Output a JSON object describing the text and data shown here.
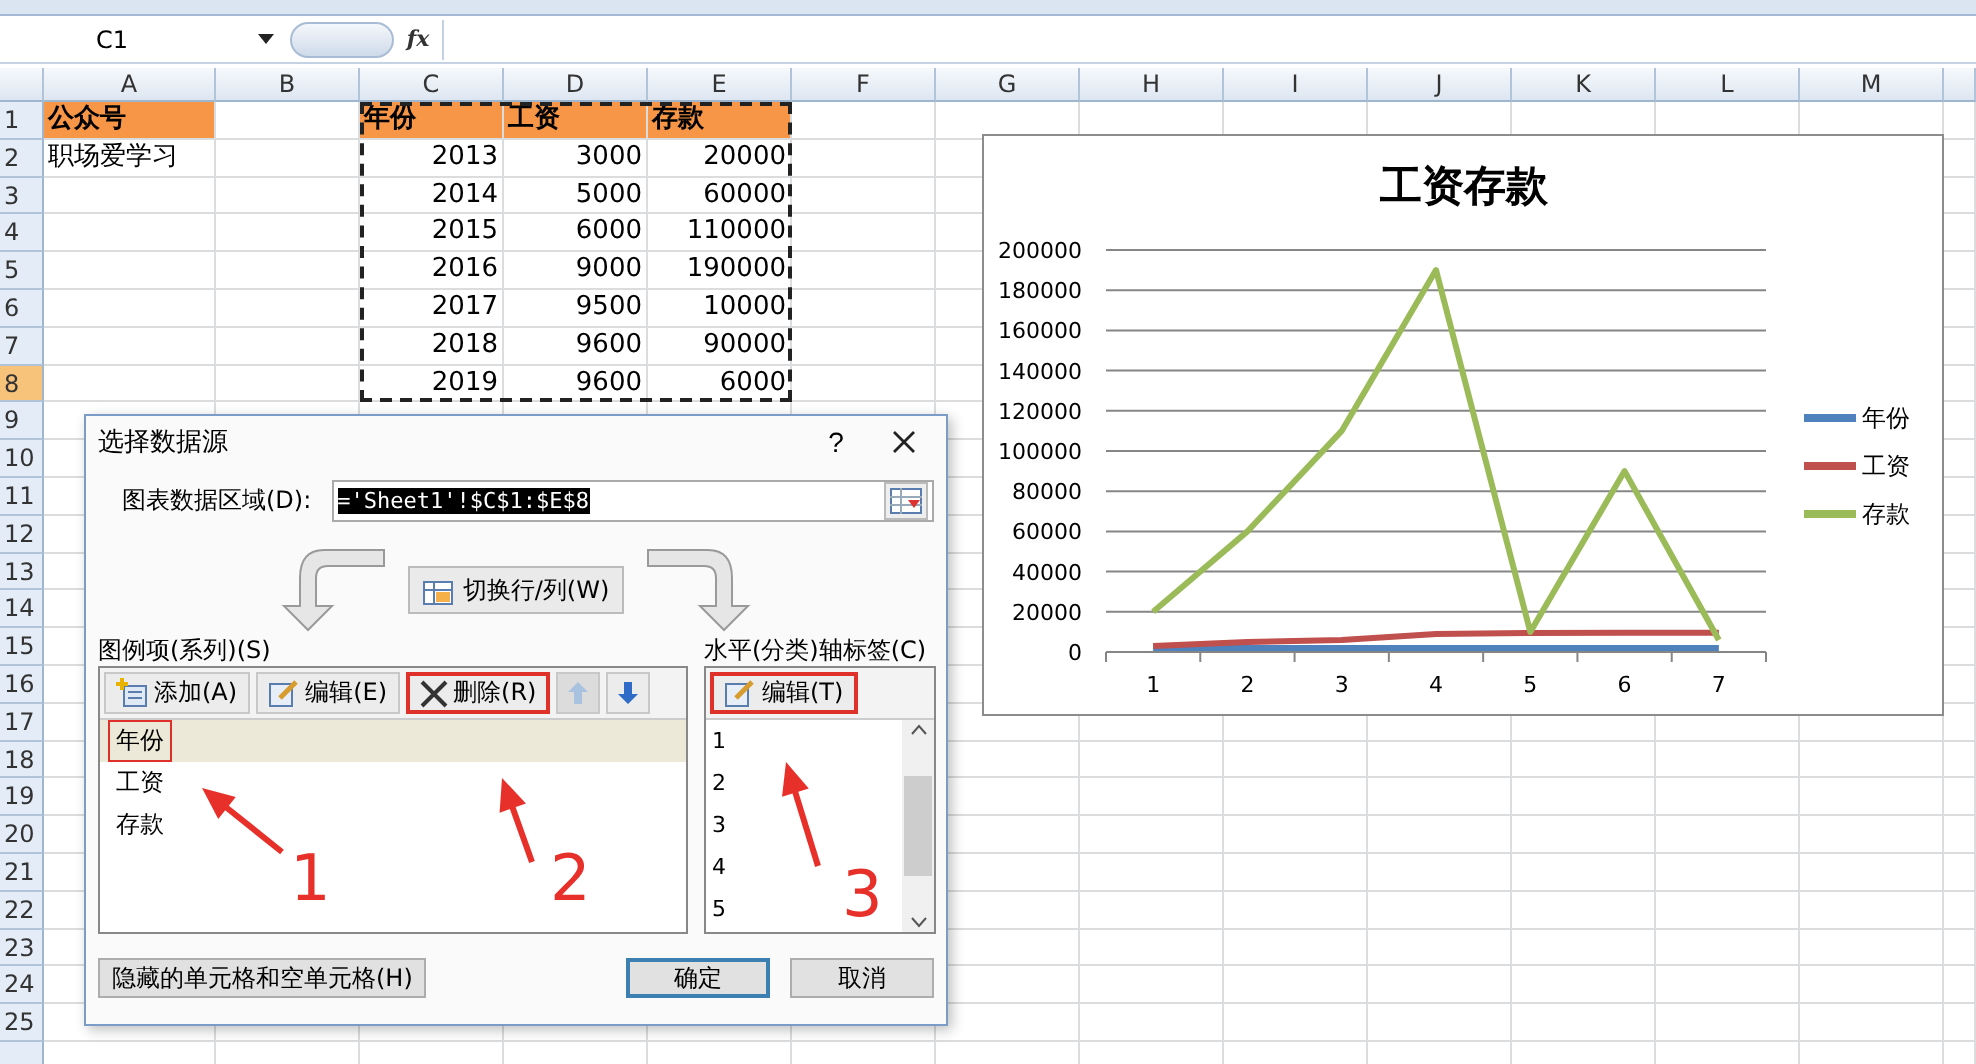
{
  "name_box": {
    "value": "C1"
  },
  "formula_bar": {
    "fx_label": "fx"
  },
  "columns": [
    "A",
    "B",
    "C",
    "D",
    "E",
    "F",
    "G",
    "H",
    "I",
    "J",
    "K",
    "L",
    "M"
  ],
  "rows": [
    {
      "header": "1",
      "selected": false,
      "cells": [
        {
          "kind": "header",
          "text": "公众号"
        },
        {
          "kind": "empty"
        },
        {
          "kind": "header",
          "text": "年份"
        },
        {
          "kind": "header",
          "text": "工资"
        },
        {
          "kind": "header",
          "text": "存款"
        }
      ]
    },
    {
      "header": "2",
      "selected": false,
      "cells": [
        {
          "kind": "text",
          "text": "职场爱学习"
        },
        {
          "kind": "empty"
        },
        {
          "kind": "number",
          "text": "2013"
        },
        {
          "kind": "number",
          "text": "3000"
        },
        {
          "kind": "number",
          "text": "20000"
        }
      ]
    },
    {
      "header": "3",
      "selected": false,
      "cells": [
        {
          "kind": "empty"
        },
        {
          "kind": "empty"
        },
        {
          "kind": "number",
          "text": "2014"
        },
        {
          "kind": "number",
          "text": "5000"
        },
        {
          "kind": "number",
          "text": "60000"
        }
      ]
    },
    {
      "header": "4",
      "selected": false,
      "cells": [
        {
          "kind": "empty"
        },
        {
          "kind": "empty"
        },
        {
          "kind": "number",
          "text": "2015"
        },
        {
          "kind": "number",
          "text": "6000"
        },
        {
          "kind": "number",
          "text": "110000"
        }
      ]
    },
    {
      "header": "5",
      "selected": false,
      "cells": [
        {
          "kind": "empty"
        },
        {
          "kind": "empty"
        },
        {
          "kind": "number",
          "text": "2016"
        },
        {
          "kind": "number",
          "text": "9000"
        },
        {
          "kind": "number",
          "text": "190000"
        }
      ]
    },
    {
      "header": "6",
      "selected": false,
      "cells": [
        {
          "kind": "empty"
        },
        {
          "kind": "empty"
        },
        {
          "kind": "number",
          "text": "2017"
        },
        {
          "kind": "number",
          "text": "9500"
        },
        {
          "kind": "number",
          "text": "10000"
        }
      ]
    },
    {
      "header": "7",
      "selected": false,
      "cells": [
        {
          "kind": "empty"
        },
        {
          "kind": "empty"
        },
        {
          "kind": "number",
          "text": "2018"
        },
        {
          "kind": "number",
          "text": "9600"
        },
        {
          "kind": "number",
          "text": "90000"
        }
      ]
    },
    {
      "header": "8",
      "selected": true,
      "cells": [
        {
          "kind": "empty"
        },
        {
          "kind": "empty"
        },
        {
          "kind": "number",
          "text": "2019"
        },
        {
          "kind": "number",
          "text": "9600"
        },
        {
          "kind": "number",
          "text": "6000"
        }
      ]
    },
    {
      "header": "9",
      "selected": false
    },
    {
      "header": "10",
      "selected": false
    },
    {
      "header": "11",
      "selected": false
    },
    {
      "header": "12",
      "selected": false
    },
    {
      "header": "13",
      "selected": false
    },
    {
      "header": "14",
      "selected": false
    },
    {
      "header": "15",
      "selected": false
    },
    {
      "header": "16",
      "selected": false
    },
    {
      "header": "17",
      "selected": false
    },
    {
      "header": "18",
      "selected": false
    },
    {
      "header": "19",
      "selected": false
    },
    {
      "header": "20",
      "selected": false
    },
    {
      "header": "21",
      "selected": false
    },
    {
      "header": "22",
      "selected": false
    },
    {
      "header": "23",
      "selected": false
    },
    {
      "header": "24",
      "selected": false
    },
    {
      "header": "25",
      "selected": false
    }
  ],
  "chart": {
    "chart_data": {
      "type": "line",
      "title": "工资存款",
      "grid": true,
      "legend": true,
      "categories": [
        "1",
        "2",
        "3",
        "4",
        "5",
        "6",
        "7"
      ],
      "series": [
        {
          "name": "年份",
          "color": "#4f81bd",
          "values": [
            2013,
            2014,
            2015,
            2016,
            2017,
            2018,
            2019
          ]
        },
        {
          "name": "工资",
          "color": "#c0504d",
          "values": [
            3000,
            5000,
            6000,
            9000,
            9500,
            9600,
            9600
          ]
        },
        {
          "name": "存款",
          "color": "#9bbb59",
          "values": [
            20000,
            60000,
            110000,
            190000,
            10000,
            90000,
            6000
          ]
        }
      ],
      "ylim": [
        0,
        200000
      ],
      "yticks": [
        0,
        20000,
        40000,
        60000,
        80000,
        100000,
        120000,
        140000,
        160000,
        180000,
        200000
      ]
    }
  },
  "dialog": {
    "title": "选择数据源",
    "help": "?",
    "range_label": "图表数据区域(D):",
    "range_value": "='Sheet1'!$C$1:$E$8",
    "switch_button": "切换行/列(W)",
    "series_label": "图例项(系列)(S)",
    "series_buttons": [
      {
        "kind": "add",
        "label": "添加(A)",
        "highlighted": false
      },
      {
        "kind": "edit",
        "label": "编辑(E)",
        "highlighted": false
      },
      {
        "kind": "delete",
        "label": "删除(R)",
        "highlighted": true
      }
    ],
    "move_up": {
      "disabled": true
    },
    "move_down": {
      "disabled": false
    },
    "series": [
      {
        "label": "年份",
        "selected": true,
        "highlighted": true
      },
      {
        "label": "工资",
        "selected": false,
        "highlighted": false
      },
      {
        "label": "存款",
        "selected": false,
        "highlighted": false
      }
    ],
    "axis_label": "水平(分类)轴标签(C)",
    "axis_button": {
      "label": "编辑(T)",
      "highlighted": true
    },
    "axis_items": [
      "1",
      "2",
      "3",
      "4",
      "5"
    ],
    "hidden_cells_button": "隐藏的单元格和空单元格(H)",
    "ok_button": "确定",
    "cancel_button": "取消",
    "annotations": [
      "1",
      "2",
      "3"
    ]
  }
}
